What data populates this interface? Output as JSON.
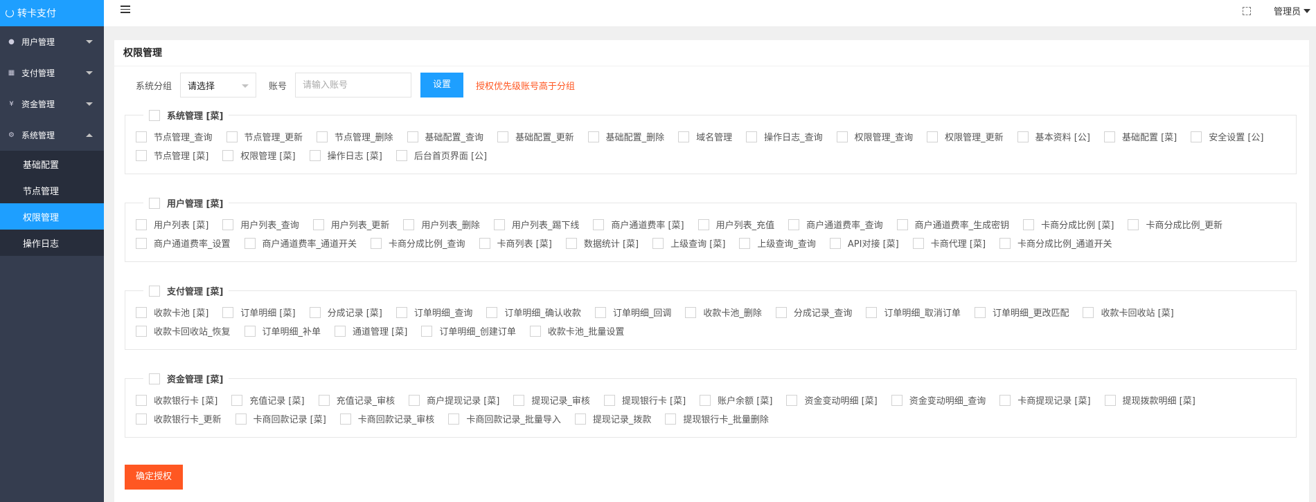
{
  "app": {
    "title": "转卡支付"
  },
  "sidebar": {
    "menus": [
      {
        "label": "用户管理",
        "icon": "users-icon"
      },
      {
        "label": "支付管理",
        "icon": "payment-icon"
      },
      {
        "label": "资金管理",
        "icon": "money-icon"
      },
      {
        "label": "系统管理",
        "icon": "gear-icon",
        "expanded": true
      }
    ],
    "sub_items": [
      {
        "label": "基础配置",
        "active": false
      },
      {
        "label": "节点管理",
        "active": false
      },
      {
        "label": "权限管理",
        "active": true
      },
      {
        "label": "操作日志",
        "active": false
      }
    ]
  },
  "header": {
    "user": "管理员"
  },
  "page": {
    "title": "权限管理",
    "group_label": "系统分组",
    "group_select_value": "请选择",
    "account_label": "账号",
    "account_placeholder": "请输入账号",
    "set_button": "设置",
    "note": "授权优先级账号高于分组",
    "submit_button": "确定授权"
  },
  "groups": [
    {
      "title": "系统管理 [菜]",
      "items": [
        "节点管理_查询",
        "节点管理_更新",
        "节点管理_删除",
        "基础配置_查询",
        "基础配置_更新",
        "基础配置_删除",
        "域名管理",
        "操作日志_查询",
        "权限管理_查询",
        "权限管理_更新",
        "基本资料 [公]",
        "基础配置 [菜]",
        "安全设置 [公]",
        "节点管理 [菜]",
        "权限管理 [菜]",
        "操作日志 [菜]",
        "后台首页界面 [公]"
      ]
    },
    {
      "title": "用户管理 [菜]",
      "items": [
        "用户列表 [菜]",
        "用户列表_查询",
        "用户列表_更新",
        "用户列表_删除",
        "用户列表_踢下线",
        "商户通道费率 [菜]",
        "用户列表_充值",
        "商户通道费率_查询",
        "商户通道费率_生成密钥",
        "卡商分成比例 [菜]",
        "卡商分成比例_更新",
        "商户通道费率_设置",
        "商户通道费率_通道开关",
        "卡商分成比例_查询",
        "卡商列表 [菜]",
        "数据统计 [菜]",
        "上级查询 [菜]",
        "上级查询_查询",
        "API对接 [菜]",
        "卡商代理 [菜]",
        "卡商分成比例_通道开关"
      ]
    },
    {
      "title": "支付管理 [菜]",
      "items": [
        "收款卡池 [菜]",
        "订单明细 [菜]",
        "分成记录 [菜]",
        "订单明细_查询",
        "订单明细_确认收款",
        "订单明细_回调",
        "收款卡池_删除",
        "分成记录_查询",
        "订单明细_取消订单",
        "订单明细_更改匹配",
        "收款卡回收站 [菜]",
        "收款卡回收站_恢复",
        "订单明细_补单",
        "通道管理 [菜]",
        "订单明细_创建订单",
        "收款卡池_批量设置"
      ]
    },
    {
      "title": "资金管理 [菜]",
      "items": [
        "收款银行卡 [菜]",
        "充值记录 [菜]",
        "充值记录_审核",
        "商户提现记录 [菜]",
        "提现记录_审核",
        "提现银行卡 [菜]",
        "账户余额 [菜]",
        "资金变动明细 [菜]",
        "资金变动明细_查询",
        "卡商提现记录 [菜]",
        "提现拨款明细 [菜]",
        "收款银行卡_更新",
        "卡商回款记录 [菜]",
        "卡商回款记录_审核",
        "卡商回款记录_批量导入",
        "提现记录_拨款",
        "提现银行卡_批量删除"
      ]
    }
  ]
}
